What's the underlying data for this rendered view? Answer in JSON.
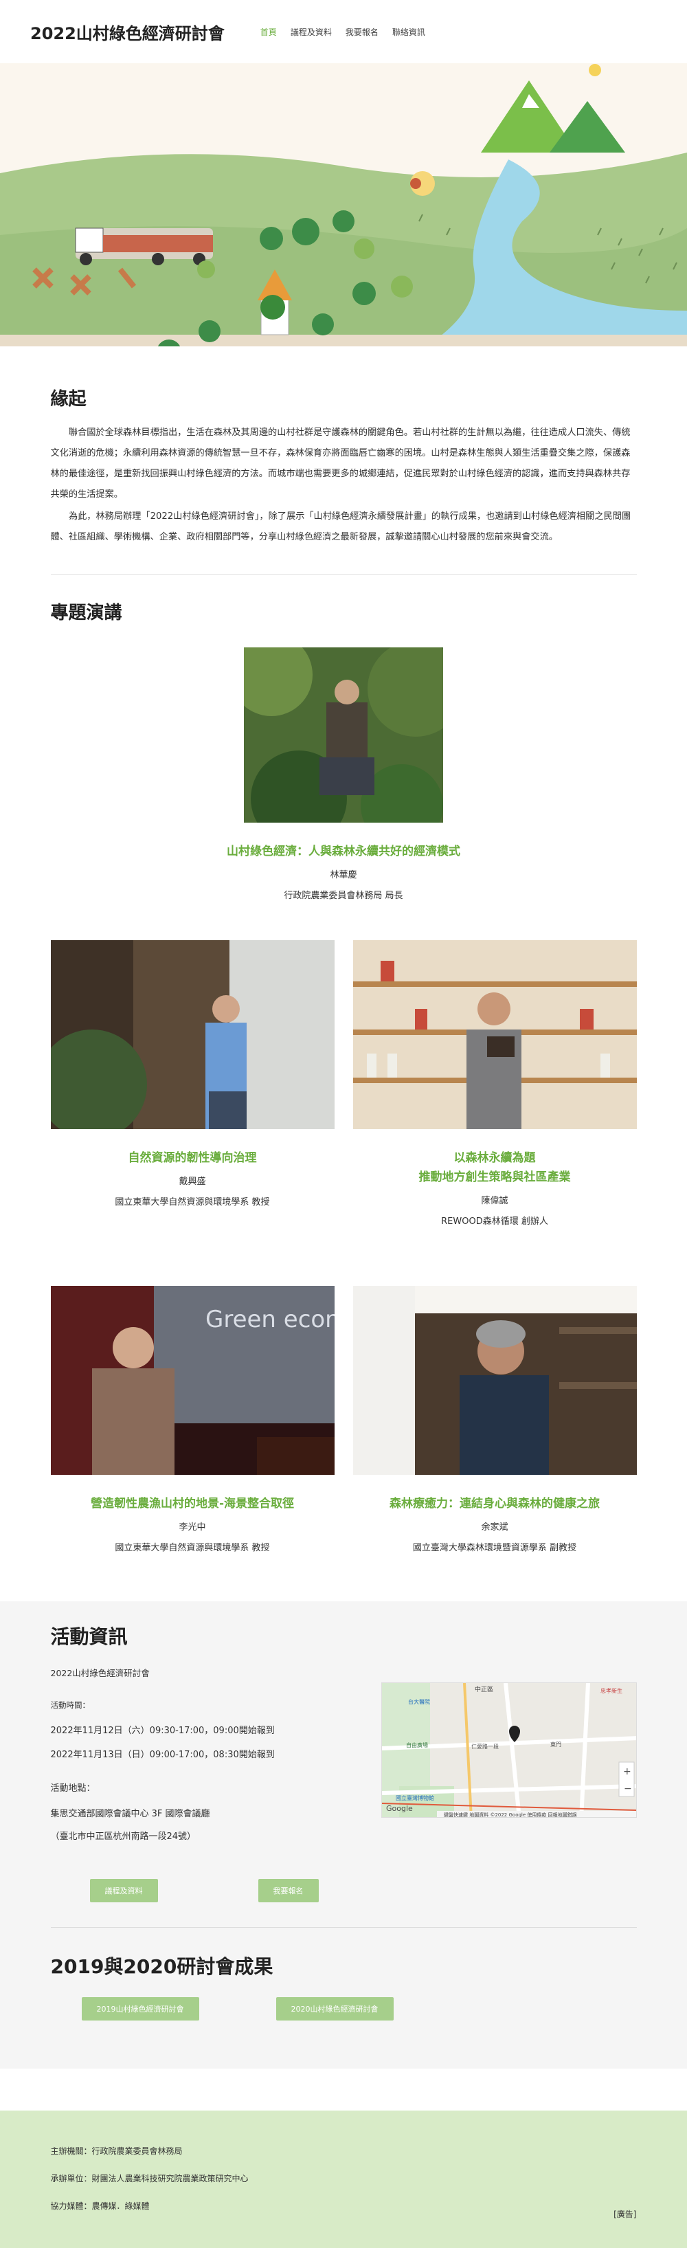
{
  "site": {
    "title": "2022山村綠色經濟研討會"
  },
  "nav": [
    {
      "label": "首頁",
      "active": true
    },
    {
      "label": "議程及資料",
      "active": false
    },
    {
      "label": "我要報名",
      "active": false
    },
    {
      "label": "聯絡資訊",
      "active": false
    }
  ],
  "origin": {
    "heading": "緣起",
    "p1": "聯合國於全球森林目標指出，生活在森林及其周邊的山村社群是守護森林的關鍵角色。若山村社群的生計無以為繼，往往造成人口流失、傳統文化消逝的危機；永續利用森林資源的傳統智慧一旦不存，森林保育亦將面臨唇亡齒寒的困境。山村是森林生態與人類生活重疊交集之際，保護森林的最佳途徑，是重新找回振興山村綠色經濟的方法。而城市端也需要更多的城鄉連結，促進民眾對於山村綠色經濟的認識，進而支持與森林共存共榮的生活提案。",
    "p2": "為此，林務局辦理「2022山村綠色經濟研討會」，除了展示「山村綠色經濟永續發展計畫」的執行成果，也邀請到山村綠色經濟相關之民間團體、社區組織、學術機構、企業、政府相關部門等，分享山村綠色經濟之最新發展，誠摯邀請關心山村發展的您前來與會交流。"
  },
  "talks": {
    "heading": "專題演講",
    "featured": {
      "title": "山村綠色經濟：人與森林永續共好的經濟模式",
      "name": "林華慶",
      "org": "行政院農業委員會林務局 局長"
    },
    "row1": [
      {
        "title_l1": "自然資源的韌性導向治理",
        "title_l2": "",
        "name": "戴興盛",
        "org": "國立東華大學自然資源與環境學系 教授"
      },
      {
        "title_l1": "以森林永續為題",
        "title_l2": "推動地方創生策略與社區產業",
        "name": "陳偉誠",
        "org": "REWOOD森林循環 創辦人"
      }
    ],
    "row2": [
      {
        "title_l1": "營造韌性農漁山村的地景-海景整合取徑",
        "name": "李光中",
        "org": "國立東華大學自然資源與環境學系 教授"
      },
      {
        "title_l1": "森林療癒力：連結身心與森林的健康之旅",
        "name": "余家斌",
        "org": "國立臺灣大學森林環境暨資源學系 副教授"
      }
    ],
    "slide_text": "Green econom"
  },
  "info": {
    "heading": "活動資訊",
    "event_name": "2022山村綠色經濟研討會",
    "time_label": "活動時間：",
    "time1": "2022年11月12日（六）09:30-17:00，09:00開始報到",
    "time2": "2022年11月13日（日）09:00-17:00，08:30開始報到",
    "place_label": "活動地點：",
    "place1": "集思交通部國際會議中心 3F 國際會議廳",
    "place2": "（臺北市中正區杭州南路一段24號）",
    "btn_agenda": "議程及資料",
    "btn_register": "我要報名",
    "map": {
      "label_top": "中正區",
      "label_tr": "忠孝新生",
      "label_l": "台大醫院",
      "label_m1": "仁愛路一段",
      "label_m2": "東門",
      "label_bl": "國立臺灣博物館",
      "label_bl2": "自由廣場",
      "google": "Google",
      "footer": "鍵盤快速鍵  地圖資料 ©2022 Google  使用條款  回報地圖錯誤"
    }
  },
  "results": {
    "heading": "2019與2020研討會成果",
    "btn1": "2019山村綠色經濟研討會",
    "btn2": "2020山村綠色經濟研討會"
  },
  "footer": {
    "line1": "主辦機關：行政院農業委員會林務局",
    "line2": "承辦單位：財團法人農業科技研究院農業政策研究中心",
    "line3": "協力媒體：農傳媒．綠媒體",
    "ad": "[廣告]"
  }
}
